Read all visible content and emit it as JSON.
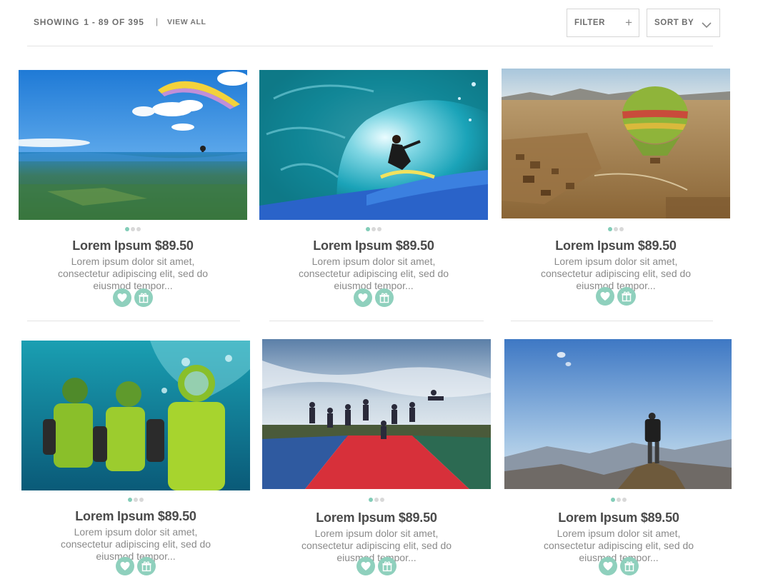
{
  "toolbar": {
    "showing_label": "SHOWING",
    "range": "1 - 89 OF 395",
    "separator": "|",
    "view_all": "VIEW ALL",
    "filter_label": "FILTER",
    "filter_icon": "plus-icon",
    "sort_label": "SORT BY",
    "sort_icon": "chevron-down-icon"
  },
  "colors": {
    "accent": "#8fd0bd",
    "dot_active": "#83cdb8",
    "dot_inactive": "#d8d8d8"
  },
  "products": [
    {
      "photo": "paraglider over valley",
      "title": "Lorem Ipsum $89.50",
      "desc": "Lorem ipsum dolor sit amet, consectetur adipiscing elit, sed do eiusmod tempor...",
      "actions": [
        "heart-icon",
        "gift-icon"
      ]
    },
    {
      "photo": "surfer in wave tube",
      "title": "Lorem Ipsum $89.50",
      "desc": "Lorem ipsum dolor sit amet, consectetur adipiscing elit, sed do eiusmod tempor...",
      "actions": [
        "heart-icon",
        "gift-icon"
      ]
    },
    {
      "photo": "hot air balloon over desert",
      "title": "Lorem Ipsum $89.50",
      "desc": "Lorem ipsum dolor sit amet, consectetur adipiscing elit, sed do eiusmod tempor...",
      "actions": [
        "heart-icon",
        "gift-icon"
      ]
    },
    {
      "photo": "underwater scooter divers",
      "title": "Lorem Ipsum $89.50",
      "desc": "Lorem ipsum dolor sit amet, consectetur adipiscing elit, sed do eiusmod tempor...",
      "actions": [
        "heart-icon",
        "gift-icon"
      ]
    },
    {
      "photo": "group jumping on trampoline",
      "title": "Lorem Ipsum $89.50",
      "desc": "Lorem ipsum dolor sit amet, consectetur adipiscing elit, sed do eiusmod tempor...",
      "actions": [
        "heart-icon",
        "gift-icon"
      ]
    },
    {
      "photo": "hiker on mountain summit",
      "title": "Lorem Ipsum $89.50",
      "desc": "Lorem ipsum dolor sit amet, consectetur adipiscing elit, sed do eiusmod tempor...",
      "actions": [
        "heart-icon",
        "gift-icon"
      ]
    }
  ]
}
